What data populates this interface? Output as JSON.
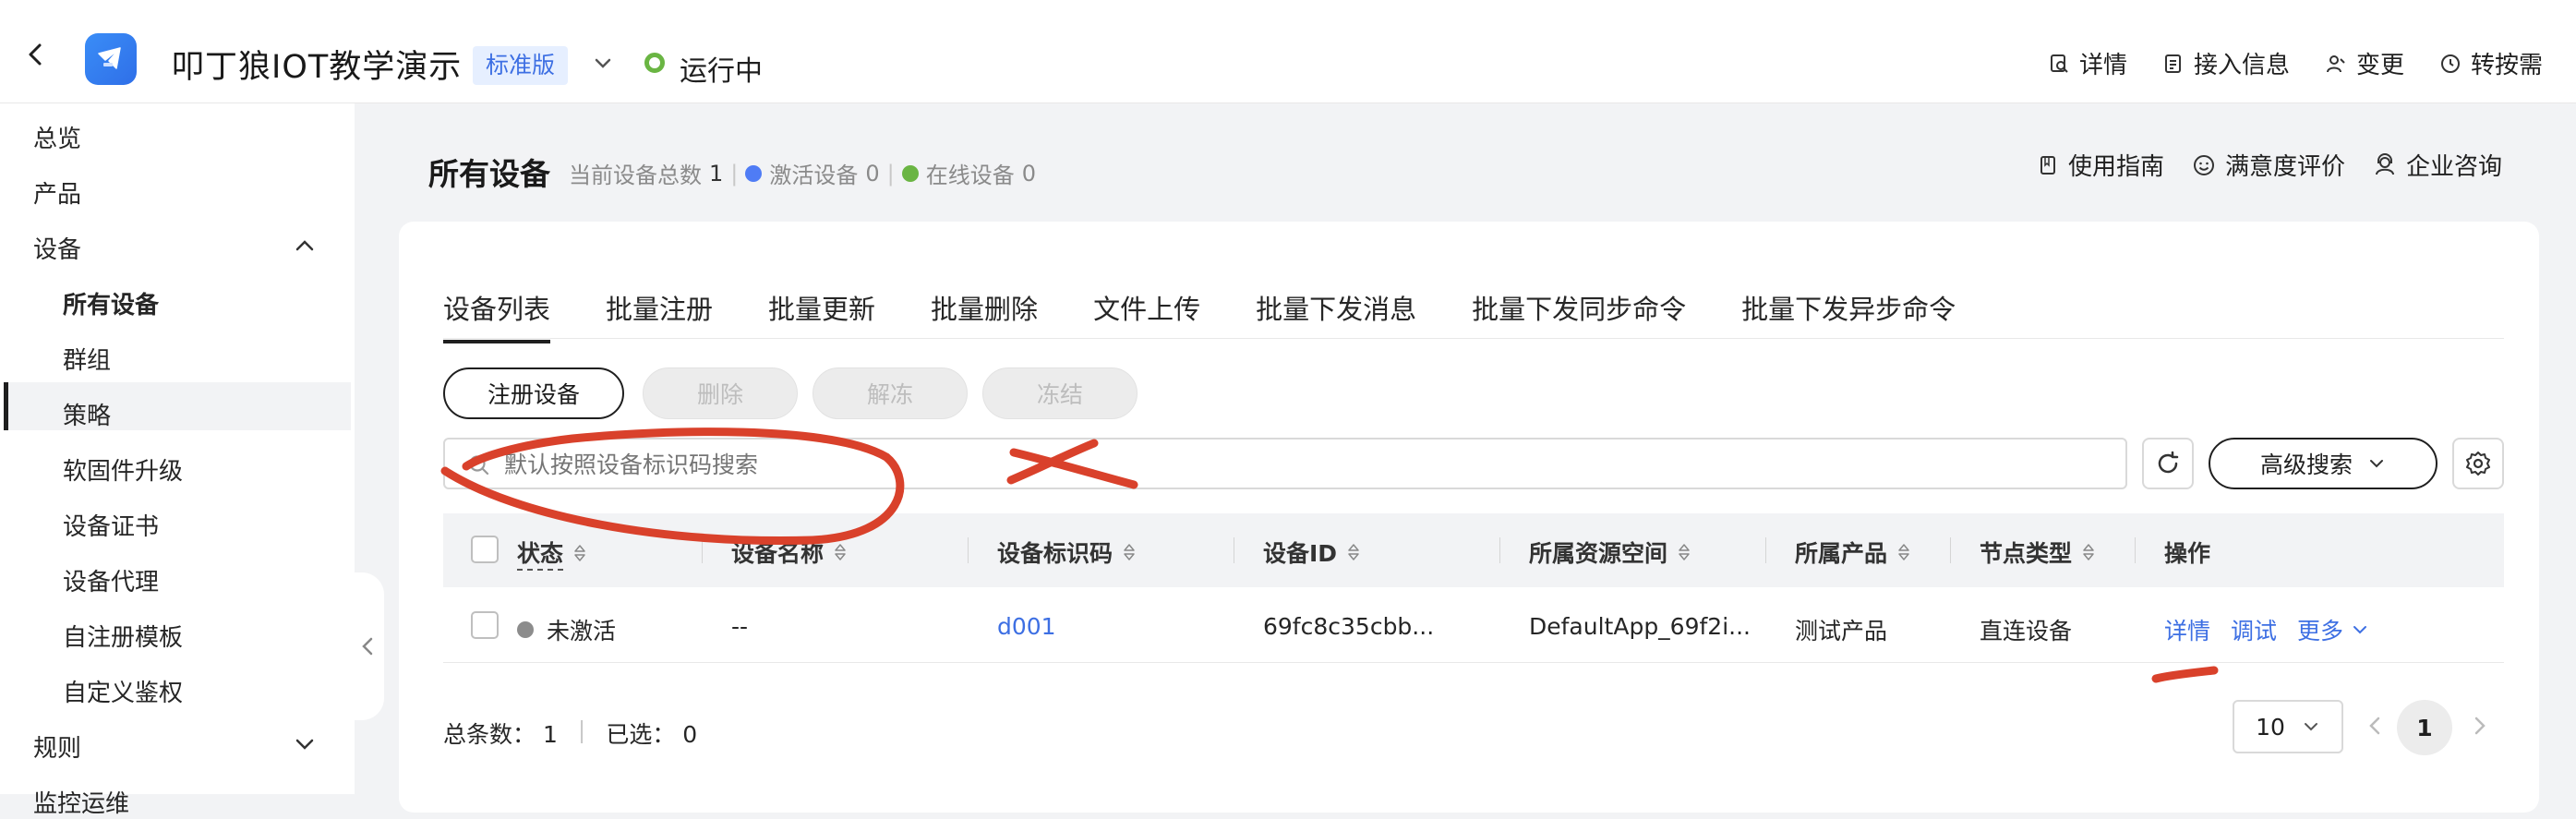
{
  "header": {
    "back_icon": "chevron-left-icon",
    "app_title": "叩丁狼IOT教学演示",
    "edition": "标准版",
    "status": "运行中",
    "status_color": "#6ab543",
    "actions": [
      "详情",
      "接入信息",
      "变更",
      "转按需"
    ]
  },
  "sidebar": {
    "items": [
      {
        "label": "总览"
      },
      {
        "label": "产品"
      },
      {
        "label": "设备"
      },
      {
        "label": "所有设备"
      },
      {
        "label": "群组"
      },
      {
        "label": "策略"
      },
      {
        "label": "软固件升级"
      },
      {
        "label": "设备证书"
      },
      {
        "label": "设备代理"
      },
      {
        "label": "自注册模板"
      },
      {
        "label": "自定义鉴权"
      },
      {
        "label": "规则"
      },
      {
        "label": "监控运维"
      }
    ],
    "active": "所有设备"
  },
  "page": {
    "title": "所有设备",
    "total_label": "当前设备总数",
    "total_value": "1",
    "activated_label": "激活设备",
    "activated_value": "0",
    "activated_color": "#4f7cf5",
    "online_label": "在线设备",
    "online_value": "0",
    "online_color": "#6ab543",
    "actions": [
      "使用指南",
      "满意度评价",
      "企业咨询"
    ]
  },
  "tabs": [
    "设备列表",
    "批量注册",
    "批量更新",
    "批量删除",
    "文件上传",
    "批量下发消息",
    "批量下发同步命令",
    "批量下发异步命令"
  ],
  "toolbar": {
    "register": "注册设备",
    "delete": "删除",
    "unfreeze": "解冻",
    "freeze": "冻结"
  },
  "search": {
    "placeholder": "默认按照设备标识码搜索",
    "advanced": "高级搜索"
  },
  "table": {
    "columns": [
      "状态",
      "设备名称",
      "设备标识码",
      "设备ID",
      "所属资源空间",
      "所属产品",
      "节点类型",
      "操作"
    ],
    "rows": [
      {
        "status": "未激活",
        "status_color": "#8c8c8c",
        "name": "--",
        "identifier": "d001",
        "device_id": "69fc8c35cbb...",
        "space": "DefaultApp_69f2i...",
        "product": "测试产品",
        "node_type": "直连设备",
        "ops": [
          "详情",
          "调试",
          "更多"
        ]
      }
    ]
  },
  "footer": {
    "total_label": "总条数：",
    "total_value": "1",
    "selected_label": "已选：",
    "selected_value": "0",
    "page_size": "10",
    "current_page": "1"
  },
  "colors": {
    "accent": "#3d6fe3",
    "annotation": "#d9412b"
  }
}
